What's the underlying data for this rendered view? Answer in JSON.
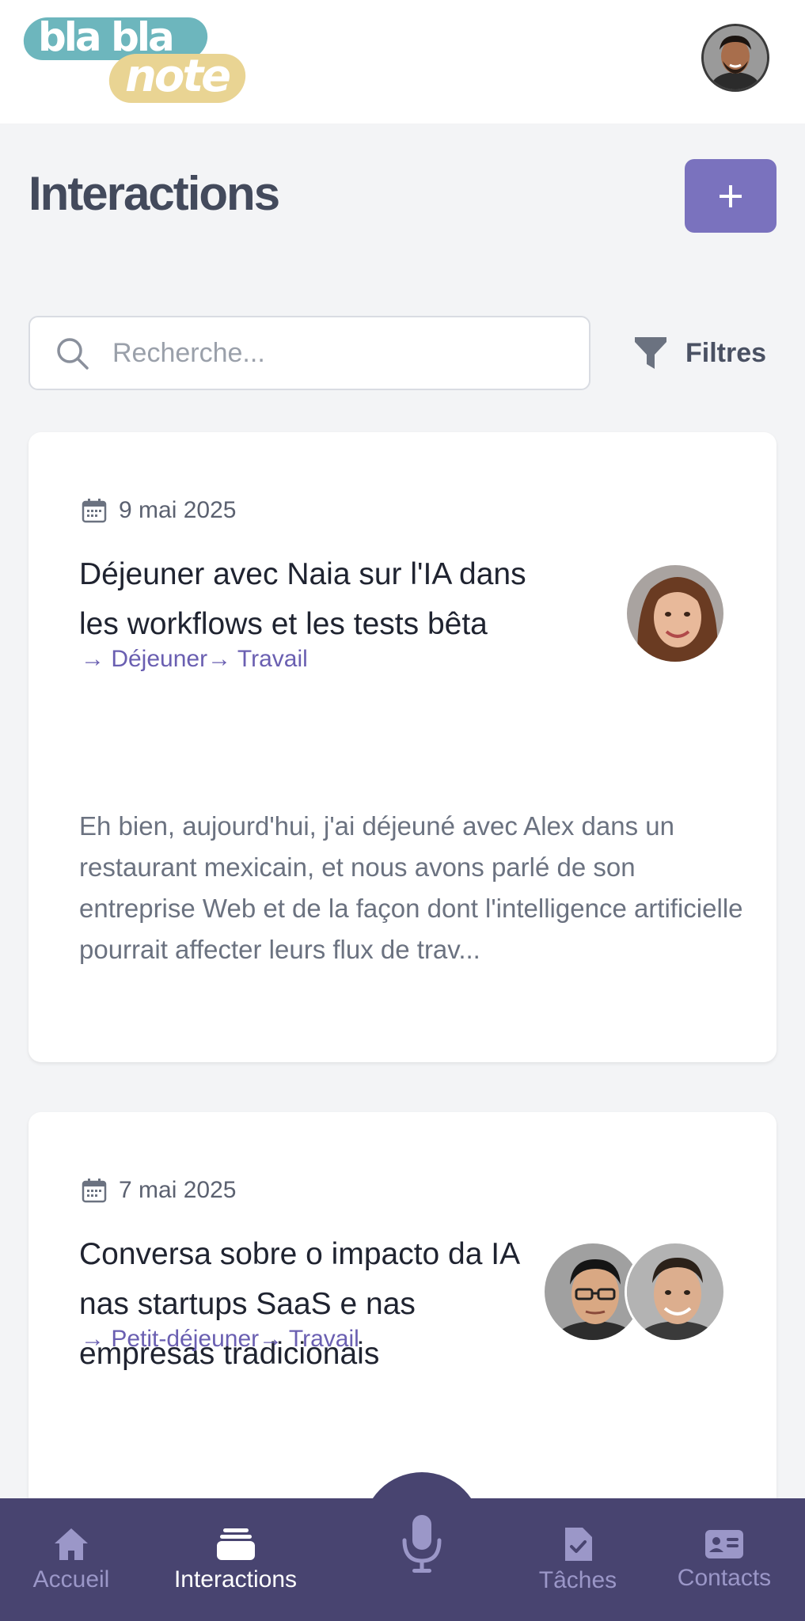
{
  "app": {
    "logo_line1": "bla bla",
    "logo_line2": "note"
  },
  "page": {
    "title": "Interactions"
  },
  "search": {
    "placeholder": "Recherche..."
  },
  "filters": {
    "label": "Filtres"
  },
  "interactions": [
    {
      "date": "9 mai 2025",
      "title": "Déjeuner avec Naia sur l'IA dans les workflows et les tests bêta",
      "tags": "→ Déjeuner→ Travail",
      "excerpt": "Eh bien, aujourd'hui, j'ai déjeuné avec Alex dans un restaurant mexicain, et nous avons parlé de son entreprise Web et de la façon dont l'intelligence artificielle pourrait affecter leurs flux de trav..."
    },
    {
      "date": "7 mai 2025",
      "title": "Conversa sobre o impacto da IA nas startups SaaS e nas empresas tradicionais",
      "tags": "→ Petit-déjeuner→ Travail"
    }
  ],
  "nav": {
    "home": "Accueil",
    "interactions": "Interactions",
    "tasks": "Tâches",
    "contacts": "Contacts"
  },
  "colors": {
    "accent": "#7a72be",
    "nav_bg": "#484470",
    "tag": "#6a5fb1",
    "logo_teal": "#6db6bd",
    "logo_yellow": "#e9d493"
  }
}
